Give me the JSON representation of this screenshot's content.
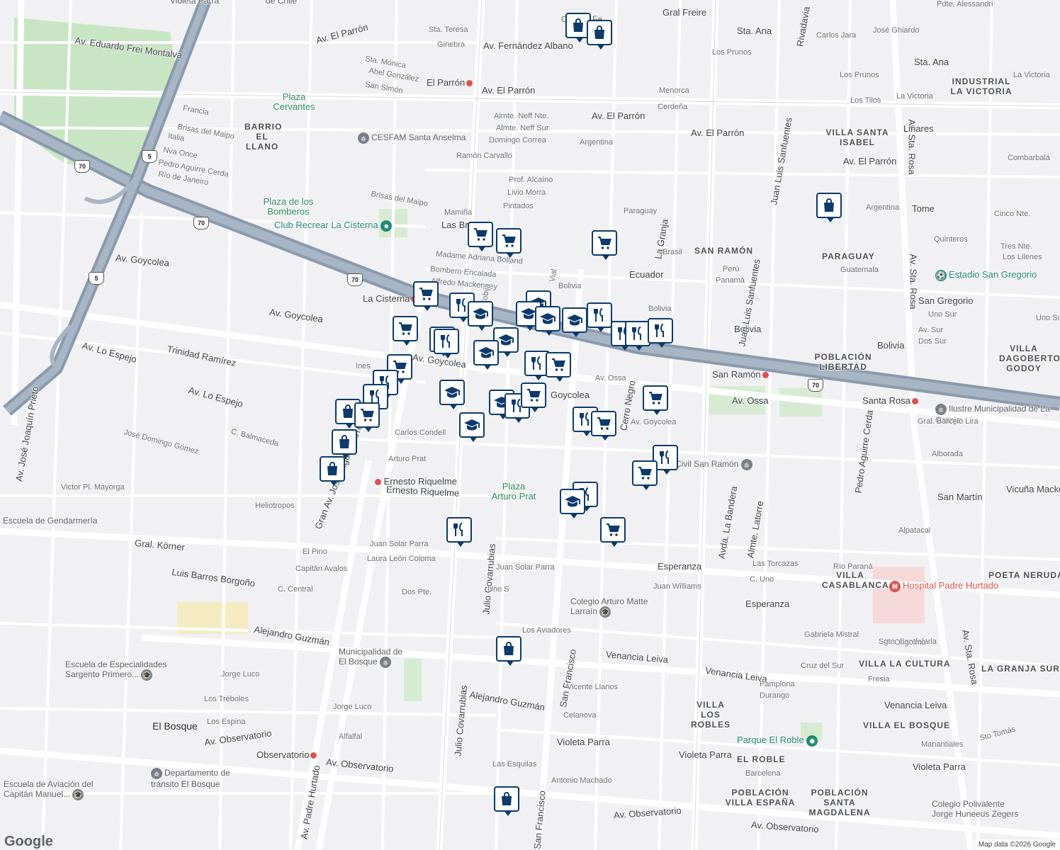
{
  "map": {
    "attribution": "Map data ©2026 Google",
    "logo": "Google",
    "districts": [
      "BARRIO EL LLANO",
      "SAN RAMÓN",
      "PARAGUAY",
      "INDUSTRIAL LA VICTORIA",
      "VILLA SANTA ISABEL",
      "POBLACIÓN LIBERTAD",
      "VILLA DAGOBERTO GODOY",
      "POETA NERUDA",
      "VILLA CASABLANCA",
      "VILLA LA CULTURA",
      "LA GRANJA SUR",
      "VILLA LOS ROBLES",
      "VILLA EL BOSQUE",
      "EL ROBLE",
      "POBLACIÓN VILLA ESPAÑA",
      "POBLACIÓN SANTA MAGDALENA"
    ],
    "city": "El Bosque",
    "parks": [
      "Plaza Cervantes",
      "Plaza de los Bomberos",
      "Plaza Arturo Prat"
    ],
    "places": {
      "club": "Club Recrear La Cisterna",
      "stadium": "Estadio San Gregorio",
      "park_roble": "Parque El Roble",
      "hospital": "Hospital Padre Hurtado",
      "cesfam": "CESFAM Santa Anselma",
      "municipalidad_granja": "Ilustre Municipalidad de La Granja",
      "municipalidad_bosque": "Municipalidad de El Bosque",
      "colegio_matte": "Colegio Arturo Matte Larraín",
      "colegio_polivalente": "Colegio Polivalente Jorge Huneeus Zegers",
      "escuela_sargento": "Escuela de Especialidades Sargento Primero...",
      "escuela_aviacion": "Escuela de Aviación del Capitán Manuel...",
      "departamento": "Departamento de tránsito El Bosque",
      "gendarmeria": "Escuela de Gendarmería",
      "registro": "Registro Civil San Ramón",
      "violeta_top": "Violeta Parra",
      "chile_top": "de Chile",
      "college_top": "Colegio Fe..."
    },
    "metro": [
      "El Parrón",
      "La Cisterna",
      "San Ramón",
      "Santa Rosa",
      "Ernesto Riquelme",
      "Observatorio"
    ],
    "highways": [
      "5",
      "70",
      "70",
      "70",
      "5",
      "70"
    ],
    "streets": {
      "frei": "Av. Eduardo Frei Montalva",
      "parron": "Av. El Parrón",
      "parron2": "Av. El Parrón",
      "parron3": "Av. El Parrón",
      "parron4": "Av. El Parrón",
      "goycolea1": "Av. Goycolea",
      "goycolea2": "Av. Goycolea",
      "goycolea3": "Av. Goycolea",
      "goycolea4": "Goycolea",
      "goycolea5": "Av. Goycolea",
      "espejo1": "Av. Lo Espejo",
      "espejo2": "Av. Lo Espejo",
      "trinidad": "Trinidad Ramírez",
      "ossa": "Av. Ossa",
      "ossa2": "Av. Ossa",
      "fernandez": "Av. Fernández Albano",
      "gralfreire": "Gral Freire",
      "stana": "Sta. Ana",
      "stana2": "Sta. Ana",
      "starosa1": "Av. Sta. Rosa",
      "starosa2": "Av. Sta. Rosa",
      "starosa3": "Av. Sta. Rosa",
      "covarrubias": "Julio Covarrubias",
      "covarrubias2": "Julio Covarrubias",
      "sanfrancisco": "San Francisco",
      "sanfrancisco2": "San Francisco",
      "riquelme": "Ernesto Riquelme",
      "korner": "Gral. Körner",
      "borgono": "Luis Barros Borgoño",
      "guzman": "Alejandro Guzmán",
      "guzman2": "Alejandro Guzmán",
      "observatorio1": "Av. Observatorio",
      "observatorio2": "Av. Observatorio",
      "observatorio3": "Av. Observatorio",
      "observatorio4": "Av. Observatorio",
      "venancia1": "Venancia Leiva",
      "venancia2": "Venancia Leiva",
      "venancia3": "Venancia Leiva",
      "violeta1": "Violeta Parra",
      "violeta2": "Violeta Parra",
      "violeta3": "Violeta Parra",
      "esperanza1": "Esperanza",
      "esperanza2": "Esperanza",
      "bolivia1": "Bolivia",
      "bolivia2": "Bolivia",
      "bolivia3": "Bolivia",
      "ecuador": "Ecuador",
      "sanfuentes": "Juan Luis Sanfuentes",
      "sanfuentes2": "Juan Luis Sanfuentes",
      "padrehurtado": "Av. Padre Hurtado",
      "gran_av": "Gran Av. José Miguel Carrera",
      "prieto": "Av. José Joaquín Prieto",
      "rivadavia": "Rivadavia",
      "labandera": "Avda. La Bandera",
      "latorre": "Almte. Latorre",
      "granja": "La Granja",
      "cerronegro": "Cerro Negro",
      "aguirre": "Pedro Aguirre Cerda",
      "condell": "Carlos Condell",
      "arturoprat": "Arturo Prat",
      "juansolar": "Juan Solar Parra",
      "juansolar2": "Juan Solar Parra",
      "sangregorio": "San Gregorio",
      "sanmartin": "San Martín",
      "vicuna": "Vicuña Mackenn",
      "tome": "Tome",
      "linares": "Linares",
      "argentina": "Argentina",
      "paraguay": "Paraguay",
      "brasil": "Brasil",
      "madame": "Madame Adriana Bolland",
      "bombero": "Bombero Encalada",
      "mackenney": "Alfredo Mackenney",
      "alameda_cerd": "Cerdeña",
      "menorca": "Menorca",
      "domingo": "Domingo Correa",
      "ramon": "Ramón Carvallo",
      "pintados": "Pintados",
      "livio": "Livio Morra",
      "alcaino": "Prof. Alcaíno",
      "neff1": "Almte. Neff Nte.",
      "neff2": "Almte. Neff Sur",
      "brisas": "Brisas del Maipo",
      "brisas2": "Brisas del Maipo",
      "francia": "Francia",
      "italia": "Italia",
      "nvaonce": "Nva Once",
      "pac": "Pedro Aguirre Cerda",
      "rio": "Río de Janeiro",
      "uno_s": "Uno S",
      "dospte": "Dos Pte.",
      "losaviadores": "Los Aviadores",
      "vicente": "Vicente Llanos",
      "celanova": "Celanova",
      "machado": "Antonio Machado",
      "esquilas": "Las Esquilas",
      "lucos": "Jorge Luco",
      "lucos2": "Jorge Luco",
      "treboles": "Los Tréboles",
      "espina": "Los Espina",
      "alfalfal": "Alfalfal",
      "central": "C. Central",
      "pino": "El Pino",
      "avalos": "Capitán Avalos",
      "laura": "Laura León Coloma",
      "balmaceda": "C. Balmaceda",
      "mayorga": "Victor Pl. Mayorga",
      "gomez": "José Domingo Gómez",
      "heliotropos": "Heliotropos",
      "alpatacal": "Alpatacal",
      "alborada": "Alborada",
      "barcelo": "Gral. Barceló Lira",
      "candelaria": "Sgto. Candelaria",
      "mistral": "Gabriela Mistral",
      "ongolmo": "Ongolmo",
      "cruzsur": "Cruz del Sur",
      "fresia": "Fresia",
      "pamplona": "Pamplona",
      "durango": "Durango",
      "barcelona": "Barcelona",
      "williams": "Juan Williams",
      "cuno": "C. Uno",
      "torcazas": "Las Torcazas",
      "parana": "Río Paraná",
      "manantiales": "Manantiales",
      "stotomas": "Sto Tomás",
      "quinteros": "Quinteros",
      "cinconte": "Cinco Nte.",
      "tresnte": "Tres Nte.",
      "lileines": "Los Lilenes",
      "guatemala": "Guatemala",
      "unosur": "Uno Sur",
      "avsur": "Av. Sur",
      "dossur": "Dos Sur",
      "unosu": "Uno Su",
      "peru": "Perú",
      "panama": "Panamá",
      "comba": "Combarbalá",
      "carlosjara": "Carlos Jara",
      "losprunos": "Los Prunos",
      "losprunos2": "Los Prunos",
      "lostilos": "Los Tilos",
      "lavictoria": "La Victoria",
      "lavictoria2": "La Victoria",
      "ghiardo": "José Ghiardo",
      "alessandri": "Pdte. Alessandri",
      "ginebra": "Ginebra",
      "sta_teresa": "Sta. Teresa",
      "sta_monica": "Sta. Mónica",
      "abel": "Abel González",
      "sansimon": "San Simón",
      "mamina": "Mamiña",
      "lasbr": "Las Br",
      "cobija": "Cobija",
      "ines": "Ines",
      "bolivia_vial": "Vial"
    },
    "marker_types": [
      "shopping-bag",
      "shopping-cart",
      "school",
      "restaurant"
    ]
  }
}
